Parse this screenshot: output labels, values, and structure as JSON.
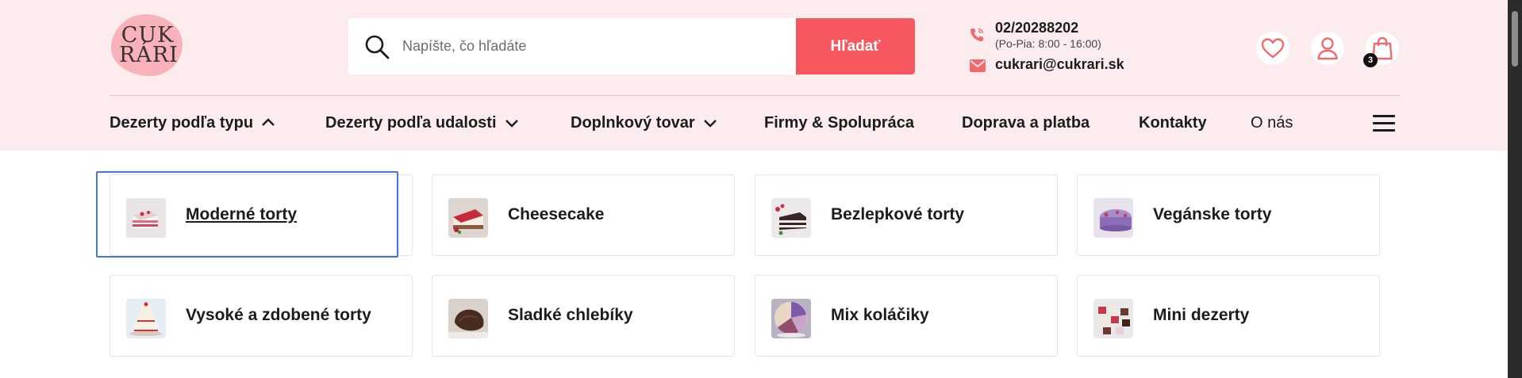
{
  "header": {
    "logo_text": "CUK RÁRI",
    "search": {
      "placeholder": "Napíšte, čo hľadáte",
      "value": "",
      "button_label": "Hľadať"
    },
    "contact": {
      "phone": "02/20288202",
      "hours": "(Po-Pia: 8:00 - 16:00)",
      "email": "cukrari@cukrari.sk"
    },
    "cart_count": "3",
    "icons": [
      "heart-icon",
      "user-icon",
      "shopping-bag-icon",
      "phone-icon",
      "mail-icon",
      "search-icon",
      "hamburger-menu-icon"
    ]
  },
  "nav": {
    "items": [
      {
        "label": "Dezerty podľa typu",
        "chevron": "up"
      },
      {
        "label": "Dezerty podľa udalosti",
        "chevron": "down"
      },
      {
        "label": "Doplnkový tovar",
        "chevron": "down"
      },
      {
        "label": "Firmy & Spolupráca",
        "chevron": ""
      },
      {
        "label": "Doprava a platba",
        "chevron": ""
      },
      {
        "label": "Kontakty",
        "chevron": ""
      },
      {
        "label": "O nás",
        "chevron": ""
      }
    ]
  },
  "categories": [
    {
      "label": "Moderné torty"
    },
    {
      "label": "Cheesecake"
    },
    {
      "label": "Bezlepkové torty"
    },
    {
      "label": "Vegánske torty"
    },
    {
      "label": "Vysoké a zdobené torty"
    },
    {
      "label": "Sladké chlebíky"
    },
    {
      "label": "Mix koláčiky"
    },
    {
      "label": "Mini dezerty"
    }
  ],
  "colors": {
    "header_bg": "#fdeced",
    "accent": "#f7575e",
    "icon_accent": "#f06a6f",
    "focus": "#4673dc"
  }
}
